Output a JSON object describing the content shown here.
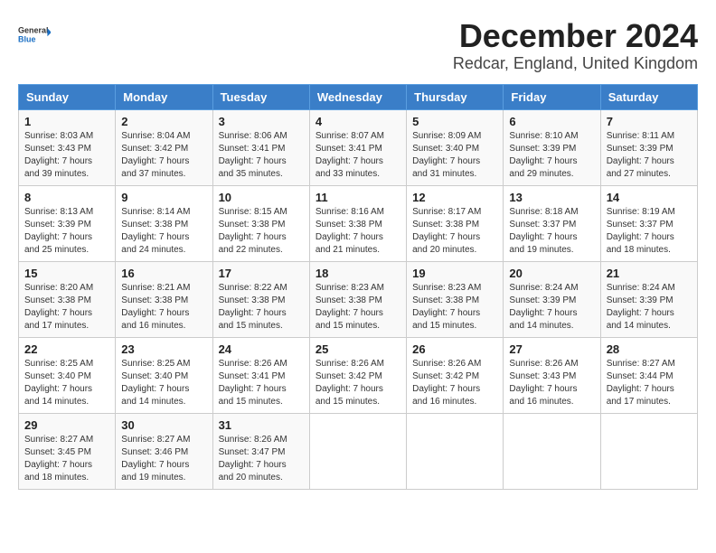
{
  "logo": {
    "general": "General",
    "blue": "Blue"
  },
  "title": "December 2024",
  "location": "Redcar, England, United Kingdom",
  "weekdays": [
    "Sunday",
    "Monday",
    "Tuesday",
    "Wednesday",
    "Thursday",
    "Friday",
    "Saturday"
  ],
  "weeks": [
    [
      {
        "day": "1",
        "sunrise": "8:03 AM",
        "sunset": "3:43 PM",
        "daylight": "7 hours and 39 minutes."
      },
      {
        "day": "2",
        "sunrise": "8:04 AM",
        "sunset": "3:42 PM",
        "daylight": "7 hours and 37 minutes."
      },
      {
        "day": "3",
        "sunrise": "8:06 AM",
        "sunset": "3:41 PM",
        "daylight": "7 hours and 35 minutes."
      },
      {
        "day": "4",
        "sunrise": "8:07 AM",
        "sunset": "3:41 PM",
        "daylight": "7 hours and 33 minutes."
      },
      {
        "day": "5",
        "sunrise": "8:09 AM",
        "sunset": "3:40 PM",
        "daylight": "7 hours and 31 minutes."
      },
      {
        "day": "6",
        "sunrise": "8:10 AM",
        "sunset": "3:39 PM",
        "daylight": "7 hours and 29 minutes."
      },
      {
        "day": "7",
        "sunrise": "8:11 AM",
        "sunset": "3:39 PM",
        "daylight": "7 hours and 27 minutes."
      }
    ],
    [
      {
        "day": "8",
        "sunrise": "8:13 AM",
        "sunset": "3:39 PM",
        "daylight": "7 hours and 25 minutes."
      },
      {
        "day": "9",
        "sunrise": "8:14 AM",
        "sunset": "3:38 PM",
        "daylight": "7 hours and 24 minutes."
      },
      {
        "day": "10",
        "sunrise": "8:15 AM",
        "sunset": "3:38 PM",
        "daylight": "7 hours and 22 minutes."
      },
      {
        "day": "11",
        "sunrise": "8:16 AM",
        "sunset": "3:38 PM",
        "daylight": "7 hours and 21 minutes."
      },
      {
        "day": "12",
        "sunrise": "8:17 AM",
        "sunset": "3:38 PM",
        "daylight": "7 hours and 20 minutes."
      },
      {
        "day": "13",
        "sunrise": "8:18 AM",
        "sunset": "3:37 PM",
        "daylight": "7 hours and 19 minutes."
      },
      {
        "day": "14",
        "sunrise": "8:19 AM",
        "sunset": "3:37 PM",
        "daylight": "7 hours and 18 minutes."
      }
    ],
    [
      {
        "day": "15",
        "sunrise": "8:20 AM",
        "sunset": "3:38 PM",
        "daylight": "7 hours and 17 minutes."
      },
      {
        "day": "16",
        "sunrise": "8:21 AM",
        "sunset": "3:38 PM",
        "daylight": "7 hours and 16 minutes."
      },
      {
        "day": "17",
        "sunrise": "8:22 AM",
        "sunset": "3:38 PM",
        "daylight": "7 hours and 15 minutes."
      },
      {
        "day": "18",
        "sunrise": "8:23 AM",
        "sunset": "3:38 PM",
        "daylight": "7 hours and 15 minutes."
      },
      {
        "day": "19",
        "sunrise": "8:23 AM",
        "sunset": "3:38 PM",
        "daylight": "7 hours and 15 minutes."
      },
      {
        "day": "20",
        "sunrise": "8:24 AM",
        "sunset": "3:39 PM",
        "daylight": "7 hours and 14 minutes."
      },
      {
        "day": "21",
        "sunrise": "8:24 AM",
        "sunset": "3:39 PM",
        "daylight": "7 hours and 14 minutes."
      }
    ],
    [
      {
        "day": "22",
        "sunrise": "8:25 AM",
        "sunset": "3:40 PM",
        "daylight": "7 hours and 14 minutes."
      },
      {
        "day": "23",
        "sunrise": "8:25 AM",
        "sunset": "3:40 PM",
        "daylight": "7 hours and 14 minutes."
      },
      {
        "day": "24",
        "sunrise": "8:26 AM",
        "sunset": "3:41 PM",
        "daylight": "7 hours and 15 minutes."
      },
      {
        "day": "25",
        "sunrise": "8:26 AM",
        "sunset": "3:42 PM",
        "daylight": "7 hours and 15 minutes."
      },
      {
        "day": "26",
        "sunrise": "8:26 AM",
        "sunset": "3:42 PM",
        "daylight": "7 hours and 16 minutes."
      },
      {
        "day": "27",
        "sunrise": "8:26 AM",
        "sunset": "3:43 PM",
        "daylight": "7 hours and 16 minutes."
      },
      {
        "day": "28",
        "sunrise": "8:27 AM",
        "sunset": "3:44 PM",
        "daylight": "7 hours and 17 minutes."
      }
    ],
    [
      {
        "day": "29",
        "sunrise": "8:27 AM",
        "sunset": "3:45 PM",
        "daylight": "7 hours and 18 minutes."
      },
      {
        "day": "30",
        "sunrise": "8:27 AM",
        "sunset": "3:46 PM",
        "daylight": "7 hours and 19 minutes."
      },
      {
        "day": "31",
        "sunrise": "8:26 AM",
        "sunset": "3:47 PM",
        "daylight": "7 hours and 20 minutes."
      },
      null,
      null,
      null,
      null
    ]
  ]
}
